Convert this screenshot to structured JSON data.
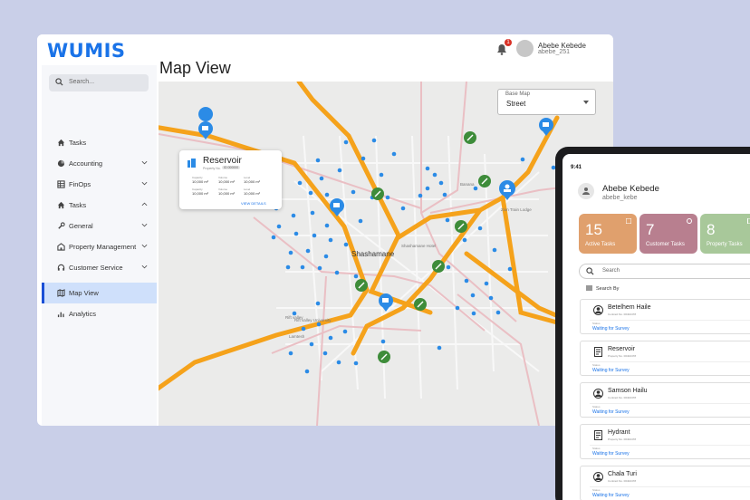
{
  "app": {
    "logo": "WUMIS",
    "notification_count": "1",
    "user": {
      "name": "Abebe Kebede",
      "handle": "abebe_251"
    }
  },
  "sidebar": {
    "search_placeholder": "Search...",
    "items": [
      {
        "label": "Tasks",
        "icon": "home-icon"
      },
      {
        "label": "Accounting",
        "icon": "pie-chart-icon",
        "chevron": "down"
      },
      {
        "label": "FinOps",
        "icon": "table-icon",
        "chevron": "down"
      },
      {
        "label": "Tasks",
        "icon": "home-icon",
        "chevron": "up"
      },
      {
        "label": "General",
        "icon": "wrench-icon",
        "chevron": "down"
      },
      {
        "label": "Property Management",
        "icon": "building-icon",
        "chevron": "down"
      },
      {
        "label": "Customer Service",
        "icon": "headset-icon",
        "chevron": "down"
      },
      {
        "label": "Map View",
        "icon": "map-icon",
        "active": true
      },
      {
        "label": "Analytics",
        "icon": "bar-chart-icon"
      }
    ]
  },
  "page": {
    "title": "Map View"
  },
  "map": {
    "base_map_label": "Base Map",
    "base_map_value": "Street",
    "city_label": "Shashamane",
    "place_labels": [
      "Banana",
      "Zion Train Lodge",
      "Rift valley",
      "Rift valley University",
      "Shashamane Hotel",
      "Lamtesh"
    ],
    "accent_road_color": "#f5a21b",
    "pin_color": "#2b8be6",
    "valve_color": "#3e8c3a",
    "popup": {
      "title": "Reservoir",
      "sub": "Property No.",
      "tag": "ID 000000",
      "cells": [
        {
          "k": "Capacity",
          "v": "10,000 m³"
        },
        {
          "k": "Volume",
          "v": "10,000 m³"
        },
        {
          "k": "Level",
          "v": "10,000 m³"
        },
        {
          "k": "Capacity",
          "v": "10,000 m³"
        },
        {
          "k": "Volume",
          "v": "10,000 m³"
        },
        {
          "k": "Level",
          "v": "10,000 m³"
        }
      ],
      "link": "VIEW DETAILS"
    }
  },
  "tablet": {
    "time": "9:41",
    "user": {
      "name": "Abebe Kebede",
      "handle": "abebe_kebe"
    },
    "stats": [
      {
        "num": "15",
        "label": "Active Tasks",
        "color": "#e0a06d"
      },
      {
        "num": "7",
        "label": "Customer Tasks",
        "color": "#b87f8f"
      },
      {
        "num": "8",
        "label": "Property Tasks",
        "color": "#a8c89a"
      }
    ],
    "search_placeholder": "Search",
    "search_by": "Search By",
    "cards": [
      {
        "name": "Betelhem Haile",
        "id": "Contract No. 00402478",
        "status_label": "Status",
        "status": "Waiting for Survey",
        "icon": "person-icon"
      },
      {
        "name": "Reservoir",
        "id": "Property No. 00402478",
        "status_label": "Status",
        "status": "Waiting for Survey",
        "icon": "document-icon"
      },
      {
        "name": "Samson Hailu",
        "id": "Contract No. 00402478",
        "status_label": "Status",
        "status": "Waiting for Survey",
        "icon": "person-icon"
      },
      {
        "name": "Hydrant",
        "id": "Property No. 00402478",
        "status_label": "Status",
        "status": "Waiting for Survey",
        "icon": "document-icon"
      },
      {
        "name": "Chala Turi",
        "id": "Contract No. 00402478",
        "status_label": "Status",
        "status": "Waiting for Survey",
        "icon": "person-icon"
      }
    ]
  }
}
